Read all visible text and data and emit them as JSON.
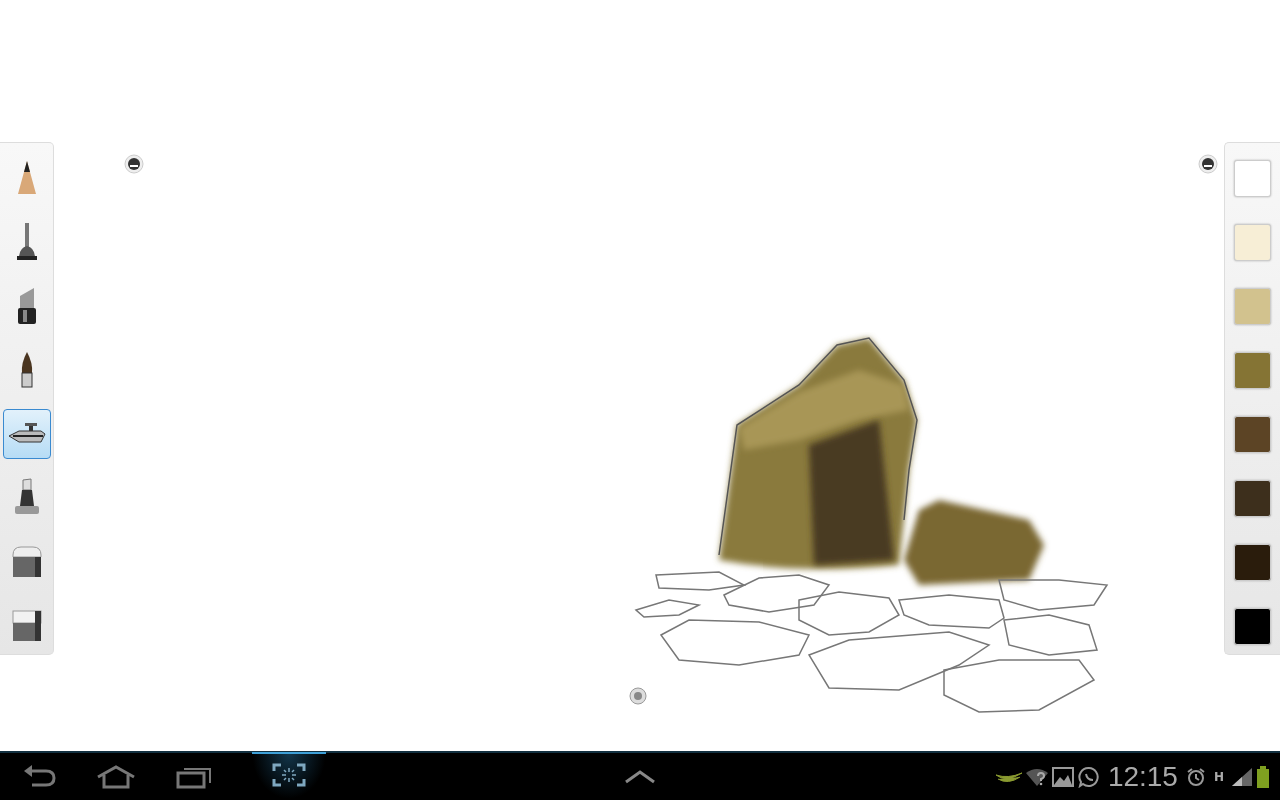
{
  "tools": [
    {
      "kind": "pencil",
      "selected": false
    },
    {
      "kind": "pen",
      "selected": false
    },
    {
      "kind": "marker",
      "selected": false
    },
    {
      "kind": "brush",
      "selected": false
    },
    {
      "kind": "airbrush",
      "selected": true
    },
    {
      "kind": "highlighter",
      "selected": false
    },
    {
      "kind": "soft-eraser",
      "selected": false
    },
    {
      "kind": "hard-eraser",
      "selected": false
    }
  ],
  "palette": [
    {
      "color": "#ffffff",
      "selected": false
    },
    {
      "color": "#f7eed6",
      "selected": false
    },
    {
      "color": "#d2c28e",
      "selected": false
    },
    {
      "color": "#857434",
      "selected": false
    },
    {
      "color": "#5c4425",
      "selected": false
    },
    {
      "color": "#3d2f1c",
      "selected": false
    },
    {
      "color": "#2a1c0c",
      "selected": false
    },
    {
      "color": "#000000",
      "selected": false
    }
  ],
  "status_bar": {
    "network": "H",
    "time": "12:15"
  }
}
